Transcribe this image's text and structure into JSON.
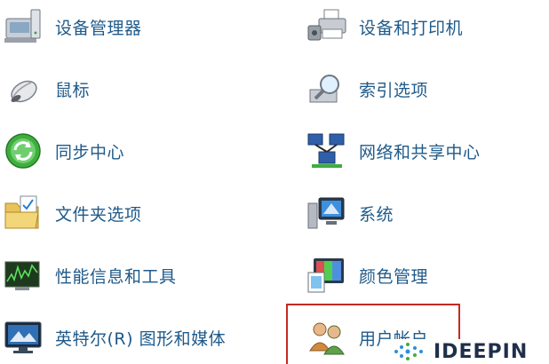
{
  "left_items": [
    {
      "label": "设备管理器",
      "icon": "device-manager-icon"
    },
    {
      "label": "鼠标",
      "icon": "mouse-icon"
    },
    {
      "label": "同步中心",
      "icon": "sync-center-icon"
    },
    {
      "label": "文件夹选项",
      "icon": "folder-options-icon"
    },
    {
      "label": "性能信息和工具",
      "icon": "performance-icon"
    },
    {
      "label": "英特尔(R) 图形和媒体",
      "icon": "intel-graphics-icon"
    }
  ],
  "right_items": [
    {
      "label": "设备和打印机",
      "icon": "printer-icon"
    },
    {
      "label": "索引选项",
      "icon": "indexing-icon"
    },
    {
      "label": "网络和共享中心",
      "icon": "network-icon"
    },
    {
      "label": "系统",
      "icon": "system-icon"
    },
    {
      "label": "颜色管理",
      "icon": "color-management-icon"
    },
    {
      "label": "用户帐户",
      "icon": "user-accounts-icon"
    }
  ],
  "watermark": {
    "text": "IDEEPIN"
  },
  "colors": {
    "label": "#1f5a8a",
    "highlight": "#c42a24"
  }
}
